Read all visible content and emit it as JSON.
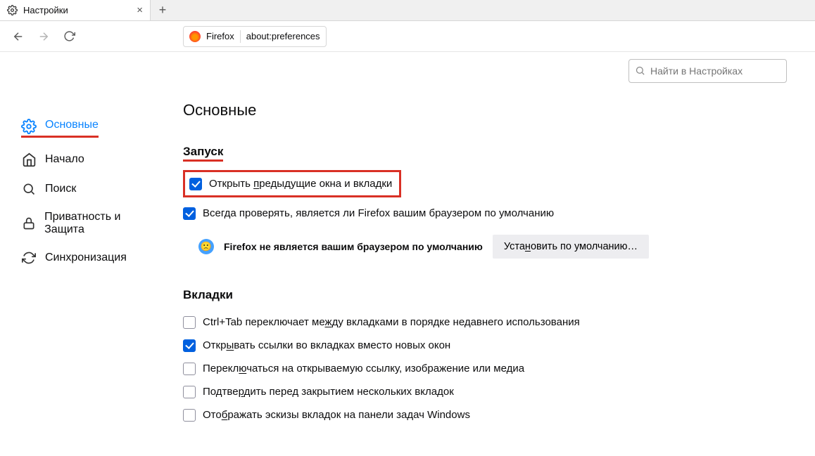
{
  "tab": {
    "title": "Настройки"
  },
  "urlbar": {
    "brand": "Firefox",
    "url": "about:preferences"
  },
  "search": {
    "placeholder": "Найти в Настройках"
  },
  "sidebar": {
    "items": [
      {
        "label": "Основные"
      },
      {
        "label": "Начало"
      },
      {
        "label": "Поиск"
      },
      {
        "label": "Приватность и Защита"
      },
      {
        "label": "Синхронизация"
      }
    ]
  },
  "content": {
    "title": "Основные",
    "startup": {
      "heading": "Запуск",
      "restore_prev_pre": "Открыть ",
      "restore_prev_hot": "п",
      "restore_prev_post": "редыдущие окна и вкладки",
      "check_default_pre": "Всег",
      "check_default_hot": "д",
      "check_default_post": "а проверять, является ли Firefox вашим браузером по умолчанию",
      "not_default": "Firefox не является вашим браузером по умолчанию",
      "set_default_pre": "Уста",
      "set_default_hot": "н",
      "set_default_post": "овить по умолчанию…"
    },
    "tabs": {
      "heading": "Вкладки",
      "ctrltab_pre": "Ctrl+Tab переключает ме",
      "ctrltab_hot": "ж",
      "ctrltab_post": "ду вкладками в порядке недавнего использования",
      "open_links_pre": "Откр",
      "open_links_hot": "ы",
      "open_links_post": "вать ссылки во вкладках вместо новых окон",
      "switch_pre": "Перекл",
      "switch_hot": "ю",
      "switch_post": "чаться на открываемую ссылку, изображение или медиа",
      "confirm_pre": "Подтве",
      "confirm_hot": "р",
      "confirm_post": "дить перед закрытием нескольких вкладок",
      "previews_pre": "Ото",
      "previews_hot": "б",
      "previews_post": "ражать эскизы вкладок на панели задач Windows"
    }
  }
}
